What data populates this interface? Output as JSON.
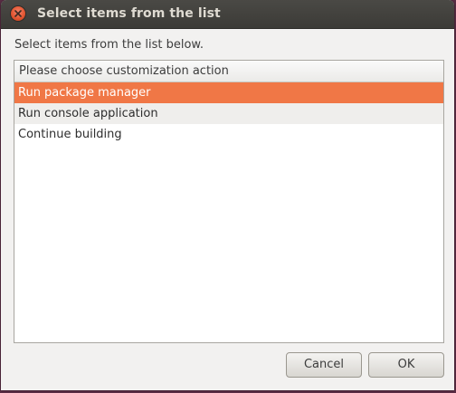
{
  "window": {
    "title": "Select items from the list"
  },
  "prompt": "Select items from the list below.",
  "list": {
    "header": "Please choose customization action",
    "items": [
      {
        "label": "Run package manager",
        "selected": true
      },
      {
        "label": "Run console application",
        "selected": false
      },
      {
        "label": "Continue building",
        "selected": false
      }
    ]
  },
  "buttons": {
    "cancel": "Cancel",
    "ok": "OK"
  },
  "colors": {
    "selection": "#f07746",
    "titlebar": "#3c3b37",
    "close_button": "#e0532e"
  }
}
